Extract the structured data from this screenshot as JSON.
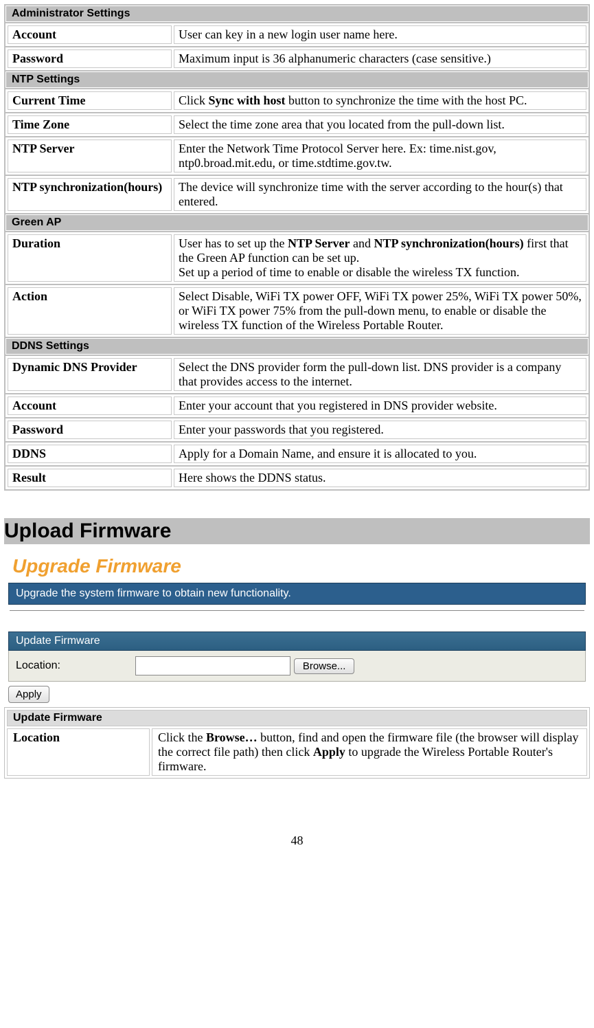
{
  "section_admin": "Administrator Settings",
  "admin_account_label": "Account",
  "admin_account_desc": "User can key in a new login user name here.",
  "admin_password_label": "Password",
  "admin_password_desc": "Maximum input is 36 alphanumeric characters (case sensitive.)",
  "section_ntp": "NTP Settings",
  "ntp_current_time_label": "Current Time",
  "ntp_current_time_pre": "Click ",
  "ntp_current_time_bold": "Sync with host",
  "ntp_current_time_post": " button to synchronize the time with the host PC.",
  "ntp_tz_label": "Time Zone",
  "ntp_tz_desc": "Select the time zone area that you located from the pull-down list.",
  "ntp_server_label": "NTP Server",
  "ntp_server_desc": "Enter the Network Time Protocol Server here. Ex: time.nist.gov, ntp0.broad.mit.edu, or time.stdtime.gov.tw.",
  "ntp_sync_label": "NTP synchronization(hours)",
  "ntp_sync_desc": "The device will synchronize time with the server according to the hour(s) that entered.",
  "section_green": "Green AP",
  "green_duration_label": "Duration",
  "green_duration_pre": "User has to set up the ",
  "green_duration_b1": "NTP Server",
  "green_duration_mid1": " and ",
  "green_duration_b2": "NTP synchronization(hours)",
  "green_duration_mid2": " first that the Green AP function can be set up.",
  "green_duration_line2": "Set up a period of time to enable or disable the wireless TX function.",
  "green_action_label": "Action",
  "green_action_desc": "Select Disable, WiFi TX power OFF, WiFi TX power 25%, WiFi TX power 50%, or WiFi TX power 75% from the pull-down menu, to enable or disable the wireless TX function of the Wireless Portable Router.",
  "section_ddns": "DDNS Settings",
  "ddns_provider_label": "Dynamic DNS Provider",
  "ddns_provider_desc": "Select the DNS provider form the pull-down list. DNS provider is a company that provides access to the internet.",
  "ddns_account_label": "Account",
  "ddns_account_desc": "Enter your account that you registered in DNS provider website.",
  "ddns_password_label": "Password",
  "ddns_password_desc": "Enter your passwords that you registered.",
  "ddns_ddns_label": "DDNS",
  "ddns_ddns_desc": "Apply for a Domain Name, and ensure it is allocated to you.",
  "ddns_result_label": "Result",
  "ddns_result_desc": "Here shows the DDNS status.",
  "h1_upload": "Upload Firmware",
  "fw_page_title": "Upgrade Firmware",
  "fw_banner": "Upgrade the system firmware to obtain new functionality.",
  "fw_update_header": "Update Firmware",
  "fw_location_label": "Location:",
  "fw_browse_btn": "Browse...",
  "fw_apply_btn": "Apply",
  "update_table_header": "Update Firmware",
  "update_location_label": "Location",
  "update_location_pre": "Click the ",
  "update_location_b1": "Browse…",
  "update_location_mid": " button, find and open the firmware file (the browser will display the correct file path) then click ",
  "update_location_b2": "Apply",
  "update_location_post": " to upgrade the Wireless Portable Router's firmware.",
  "page_number": "48"
}
